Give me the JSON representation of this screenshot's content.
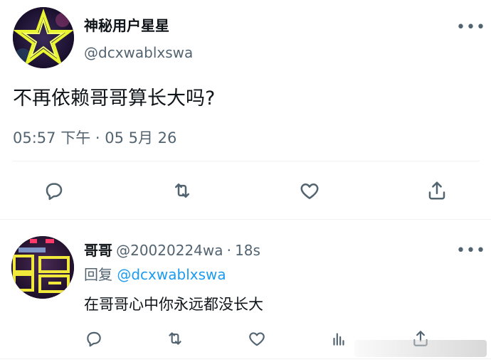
{
  "main_tweet": {
    "display_name": "神秘用户星星",
    "handle": "@dcxwablxswa",
    "text": "不再依赖哥哥算长大吗?",
    "timestamp": "05:57 下午 · 05 5月 26",
    "avatar_icon": "neon-star-icon"
  },
  "reply_tweet": {
    "display_name": "哥哥",
    "handle": "@20020224wa",
    "time_sep": "·",
    "time": "18s",
    "replying_prefix": "回复",
    "replying_to": "@dcxwablxswa",
    "text": "在哥哥心中你永远都没长大",
    "avatar_icon": "neon-sign-icon"
  },
  "more_label": "•••",
  "colors": {
    "text": "#0f1419",
    "secondary": "#536471",
    "link": "#1d9bf0",
    "divider": "#eff3f4"
  }
}
